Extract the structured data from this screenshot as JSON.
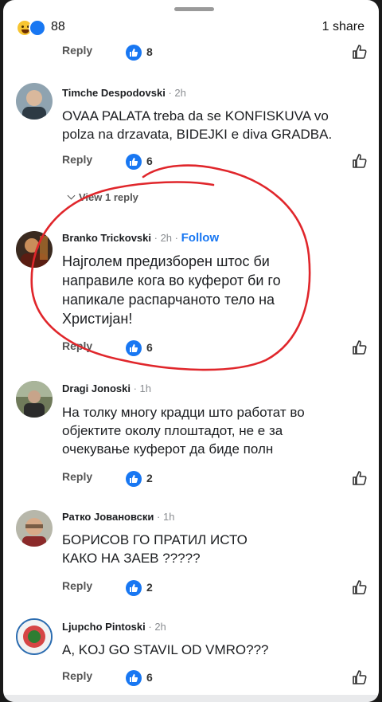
{
  "header": {
    "reaction_count": "88",
    "share_count": "1 share"
  },
  "top_action": {
    "reply_label": "Reply",
    "like_count": "8"
  },
  "comments": [
    {
      "author": "Timche Despodovski",
      "time": "2h",
      "text_lines": [
        "OVAA PALATA treba da se KONFISKUVA vo",
        "polza na drzavata, BIDEJKI e diva GRADBA."
      ],
      "reply_label": "Reply",
      "like_count": "6",
      "view_replies": "View 1 reply"
    },
    {
      "author": "Branko Trickovski",
      "time": "2h",
      "follow": "Follow",
      "text_lines": [
        "Најголем предизборен штос би",
        "направиле кога во куферот би го",
        "напикале распарчаното тело на",
        "Христијан!"
      ],
      "reply_label": "Reply",
      "like_count": "6"
    },
    {
      "author": "Dragi Jonoski",
      "time": "1h",
      "text_lines": [
        "На толку многу крадци што работат  во",
        "објектите околу плоштадот, не е за",
        "очекување куферот да биде полн"
      ],
      "reply_label": "Reply",
      "like_count": "2"
    },
    {
      "author": "Ратко Јовановски",
      "time": "1h",
      "text_lines": [
        "БОРИСОВ ГО ПРАТИЛ ИСТО",
        "КАКО  НА  ЗАЕВ ?????"
      ],
      "reply_label": "Reply",
      "like_count": "2"
    },
    {
      "author": "Ljupcho Pintoski",
      "time": "2h",
      "text_lines": [
        "A, KOJ GO STAVIL OD VMRO???"
      ],
      "reply_label": "Reply",
      "like_count": "6"
    }
  ],
  "colors": {
    "accent": "#1877f2",
    "annotation": "#e0262b"
  }
}
